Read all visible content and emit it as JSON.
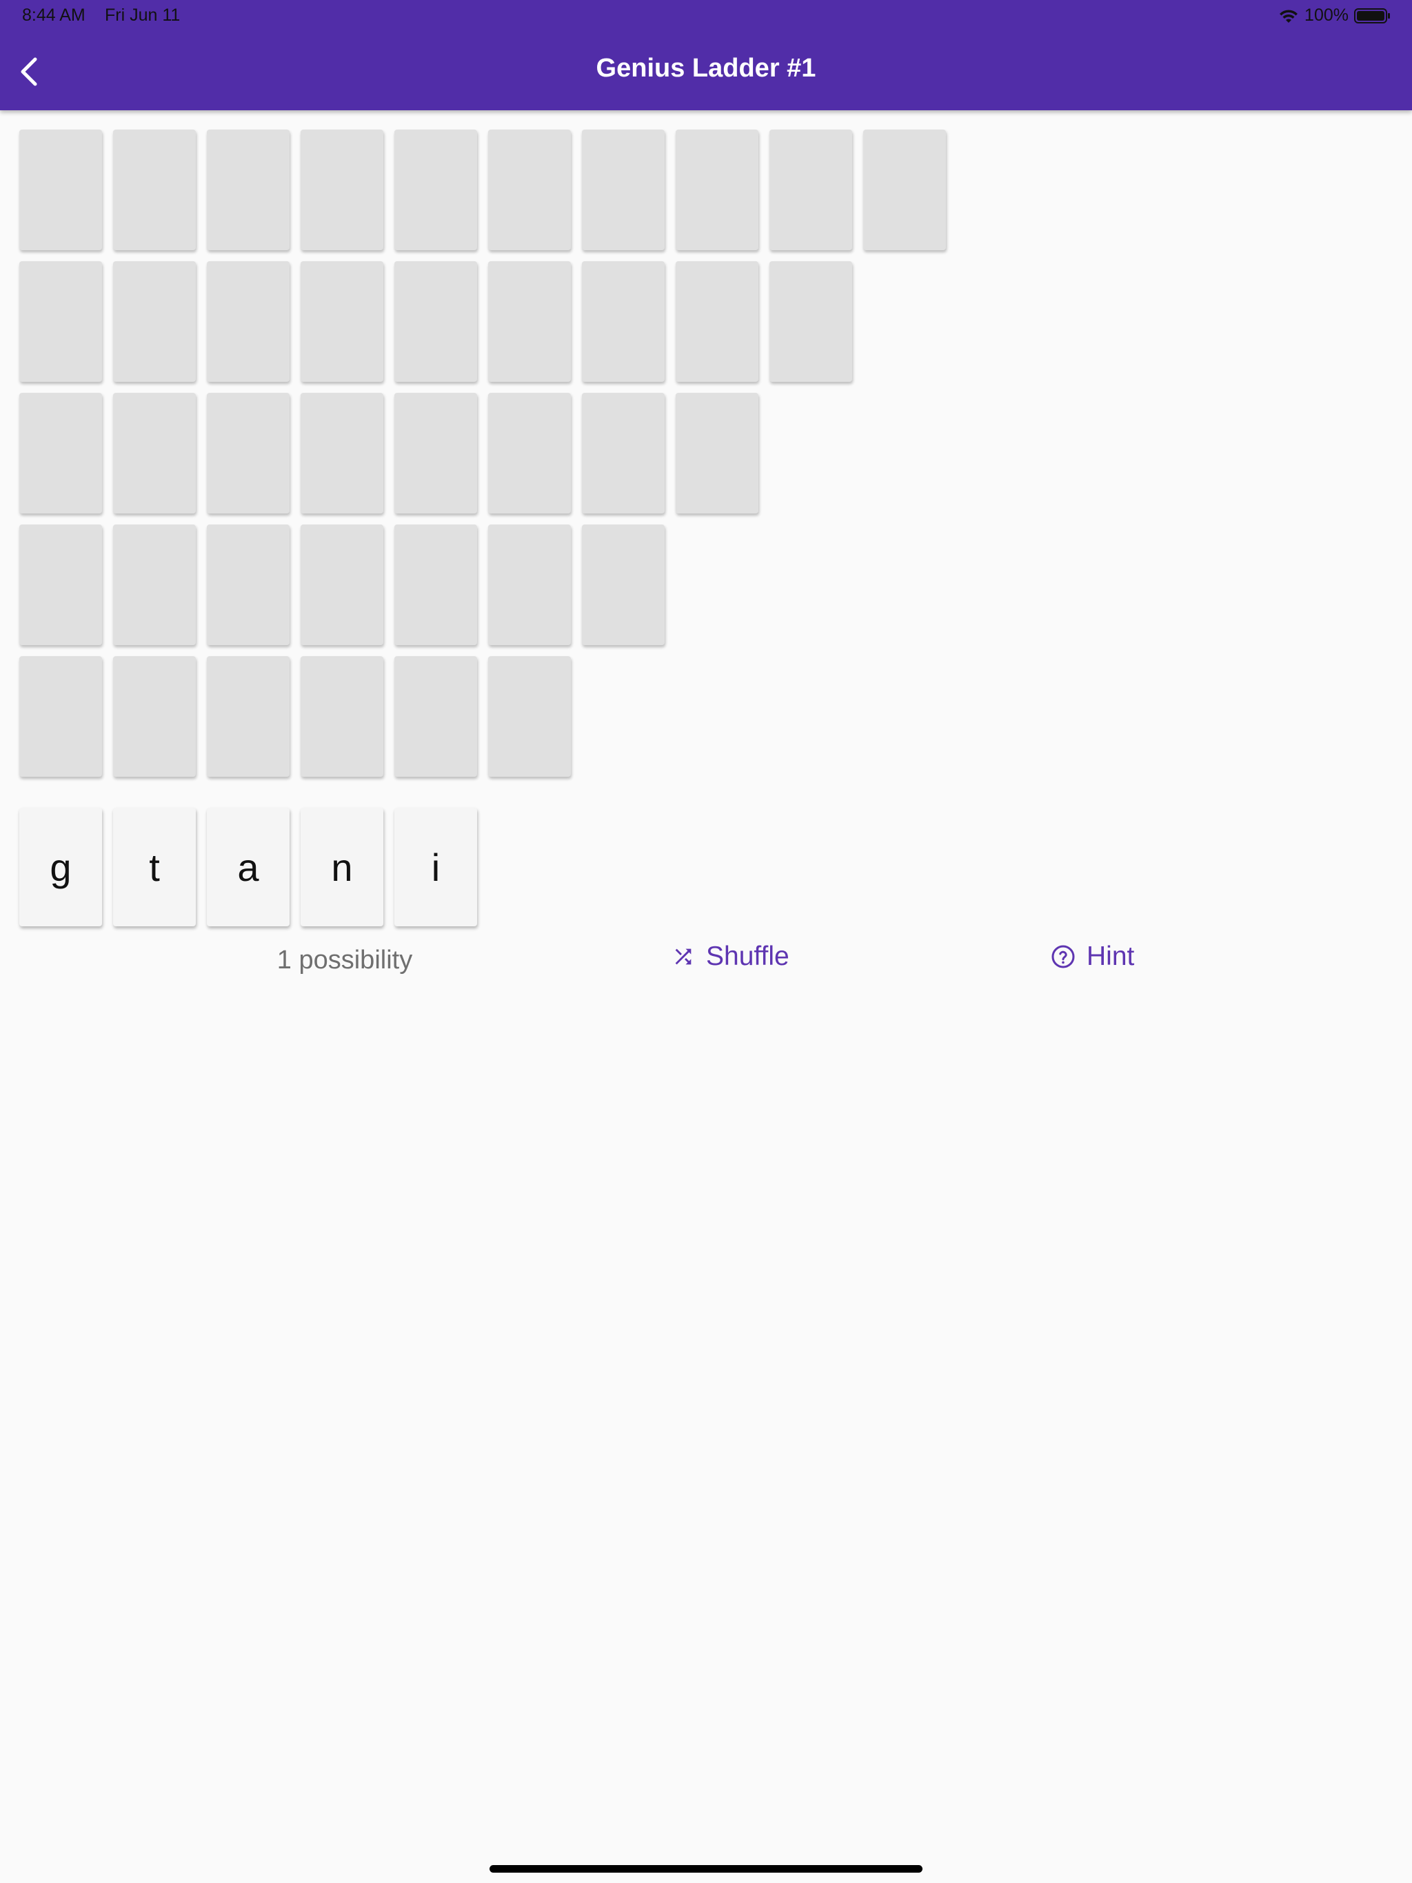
{
  "status_bar": {
    "time": "8:44 AM",
    "date": "Fri Jun 11",
    "battery": "100%"
  },
  "app_bar": {
    "title": "Genius Ladder #1",
    "back_icon": "chevron-left-icon"
  },
  "ladder": {
    "row_lengths": [
      10,
      9,
      8,
      7,
      6
    ]
  },
  "tiles": [
    "g",
    "t",
    "a",
    "n",
    "i"
  ],
  "footer": {
    "possibility_text": "1 possibility",
    "shuffle_label": "Shuffle",
    "shuffle_icon": "shuffle-icon",
    "hint_label": "Hint",
    "hint_icon": "help-circle-icon"
  },
  "colors": {
    "app_bar": "#512da8",
    "accent": "#5e35b1",
    "empty_slot": "#e0e0e0",
    "tile": "#f5f5f5"
  }
}
